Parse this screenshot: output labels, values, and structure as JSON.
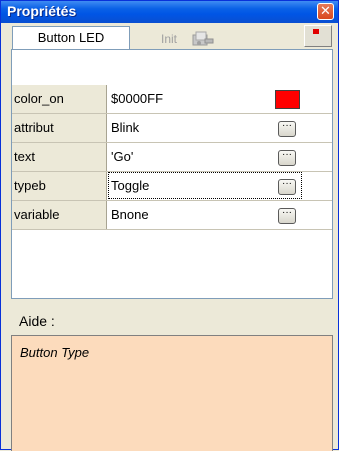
{
  "window": {
    "title": "Propriétés",
    "close_label": "✕"
  },
  "tabs": {
    "active": "Button LED",
    "inactive": "Init"
  },
  "properties": [
    {
      "key": "color_on",
      "value": "$0000FF",
      "control": "swatch",
      "swatch_color": "#ff0000"
    },
    {
      "key": "attribut",
      "value": "Blink",
      "control": "ellipsis"
    },
    {
      "key": "text",
      "value": "'Go'",
      "control": "ellipsis"
    },
    {
      "key": "typeb",
      "value": "Toggle",
      "control": "ellipsis",
      "focused": true
    },
    {
      "key": "variable",
      "value": "Bnone",
      "control": "ellipsis"
    }
  ],
  "ellipsis_label": "···",
  "aide": {
    "label": "Aide :",
    "text": "Button Type"
  }
}
